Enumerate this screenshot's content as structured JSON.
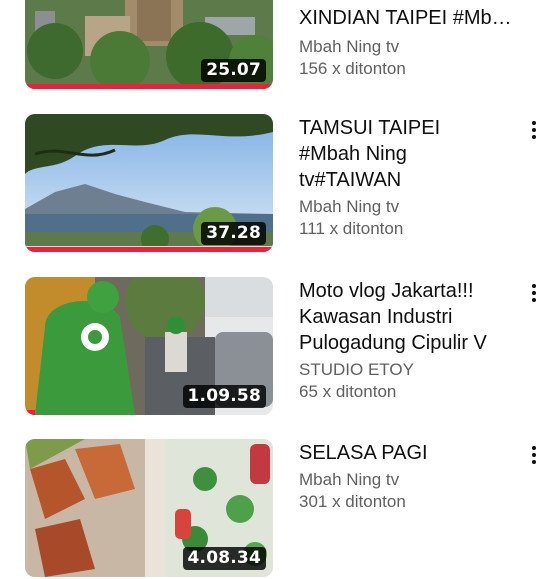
{
  "videos": [
    {
      "title": "XINDIAN TAIPEI #Mbah Ning tv",
      "channel": "Mbah Ning tv",
      "views": "156 x ditonton",
      "duration": "25.07",
      "watched": 1.0,
      "menu_icon": "more-vert-icon"
    },
    {
      "title": "TAMSUI TAIPEI\n#Mbah Ning\ntv#TAIWAN",
      "channel": "Mbah Ning tv",
      "views": "111 x ditonton",
      "duration": "37.28",
      "watched": 1.0,
      "menu_icon": "more-vert-icon"
    },
    {
      "title": "Moto vlog Jakarta!!!\nKawasan Industri\nPulogadung Cipulir V",
      "channel": "STUDIO ETOY",
      "views": "65 x ditonton",
      "duration": "1.09.58",
      "watched": 0.04,
      "menu_icon": "more-vert-icon"
    },
    {
      "title": "SELASA PAGI",
      "channel": "Mbah Ning tv",
      "views": "301 x ditonton",
      "duration": "4.08.34",
      "watched": 0.0,
      "menu_icon": "more-vert-icon"
    }
  ],
  "colors": {
    "progress": "#ee1e3c",
    "title": "#0f0f0f",
    "meta": "#606060"
  }
}
